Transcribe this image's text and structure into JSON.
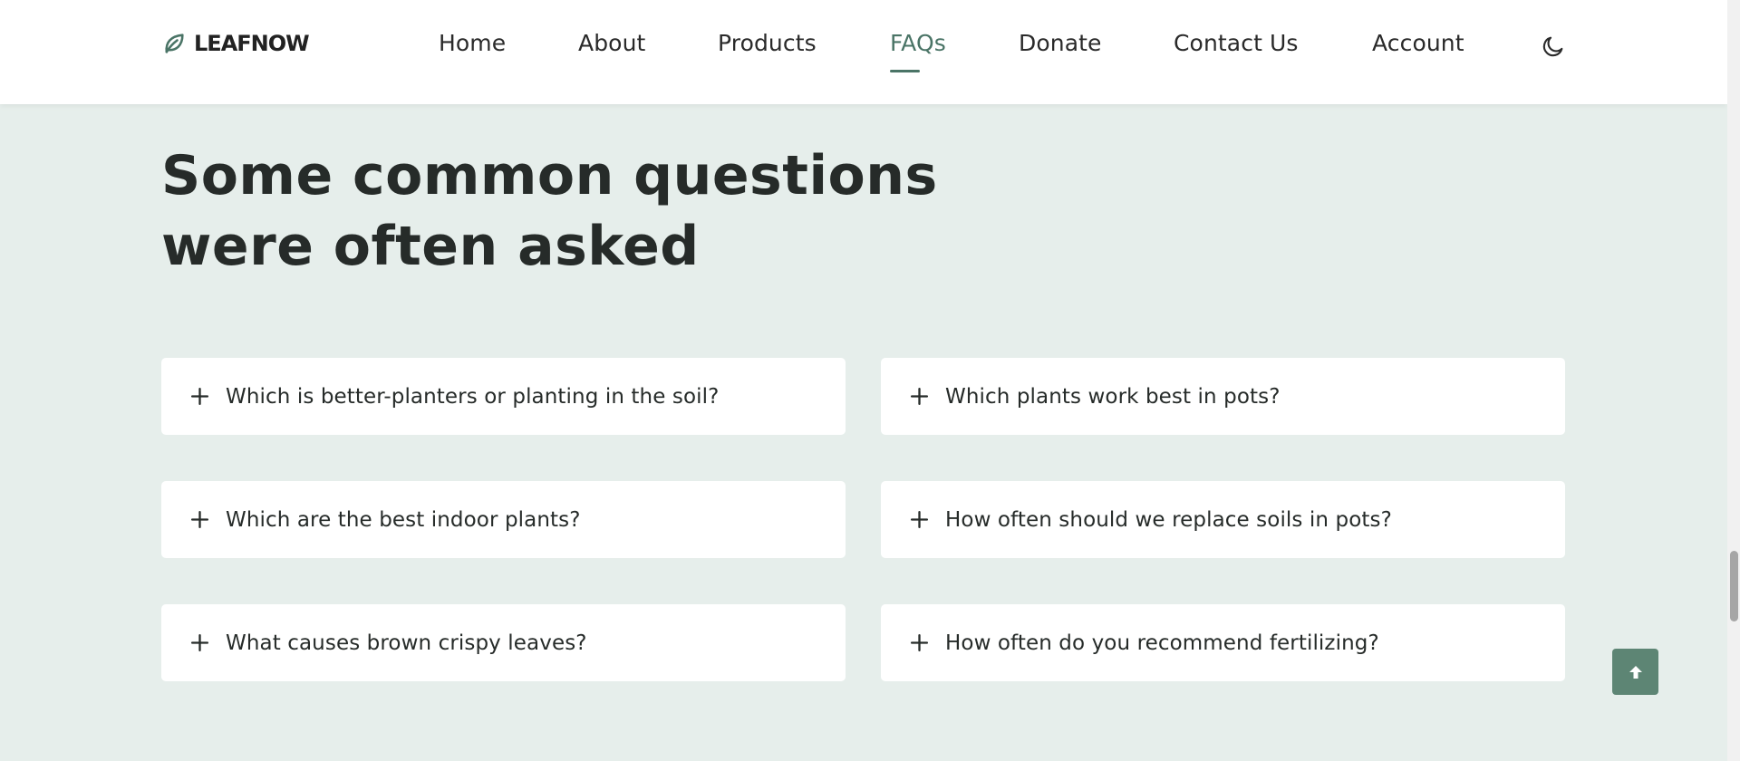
{
  "brand": {
    "name": "LEAFNOW",
    "logo_icon": "leaf-icon"
  },
  "nav": {
    "items": [
      {
        "label": "Home"
      },
      {
        "label": "About"
      },
      {
        "label": "Products"
      },
      {
        "label": "FAQs",
        "active": true
      },
      {
        "label": "Donate"
      },
      {
        "label": "Contact Us"
      },
      {
        "label": "Account"
      }
    ],
    "theme_toggle_icon": "moon-icon"
  },
  "section": {
    "title_line1": "Some common questions",
    "title_line2": "were often asked"
  },
  "faqs": [
    {
      "question": "Which is better-planters or planting in the soil?"
    },
    {
      "question": "Which plants work best in pots?"
    },
    {
      "question": "Which are the best indoor plants?"
    },
    {
      "question": "How often should we replace soils in pots?"
    },
    {
      "question": "What causes brown crispy leaves?"
    },
    {
      "question": "How often do you recommend fertilizing?"
    }
  ],
  "colors": {
    "accent": "#4a7466",
    "page_background": "#e6eeeb",
    "scroll_top_button": "#5d8574"
  },
  "scroll_top_icon": "arrow-up-icon"
}
